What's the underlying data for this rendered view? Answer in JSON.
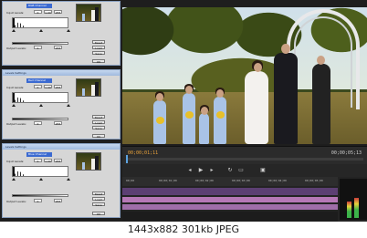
{
  "dialogs": [
    {
      "title": "",
      "channel": "RGB Channel",
      "input_label": "Input Levels:",
      "input_values": [
        "0",
        "1.00",
        "255"
      ],
      "output_label": "Output Levels:",
      "output_values": [
        "0",
        "255"
      ],
      "buttons": [
        "Reset",
        "Load",
        "Save",
        "OK"
      ]
    },
    {
      "title": "Levels Settings",
      "channel": "Red Channel",
      "input_label": "Input Levels:",
      "input_values": [
        "0",
        "1.00",
        "255"
      ],
      "output_label": "Output Levels:",
      "output_values": [
        "0",
        "255"
      ],
      "buttons": [
        "Reset",
        "Load",
        "Save",
        "OK"
      ]
    },
    {
      "title": "Levels Settings",
      "channel": "Blue Channel",
      "input_label": "Input Levels:",
      "input_values": [
        "0",
        "1.00",
        "255"
      ],
      "output_label": "Output Levels:",
      "output_values": [
        "0",
        "255"
      ],
      "buttons": [
        "Reset",
        "Load",
        "Save",
        "OK"
      ]
    }
  ],
  "monitor": {
    "timecode_current": "00;00;01;11",
    "timecode_duration": "00;00;05;13"
  },
  "transport_icons": [
    "step-back-icon",
    "play-icon",
    "step-forward-icon",
    "loop-icon",
    "safe-margins-icon",
    "export-frame-icon"
  ],
  "timeline": {
    "ruler_marks": [
      "00;00",
      "00;00;01;00",
      "00;00;02;00",
      "00;00;03;00",
      "00;00;04;00",
      "00;00;05;00"
    ]
  },
  "caption": "1443x882  301kb  JPEG",
  "colors": {
    "accent_timecode": "#e9a23b",
    "video_track": "#5c3f73",
    "audio_track": "#b678b6",
    "dialog_channel": "#3b6ad1"
  }
}
